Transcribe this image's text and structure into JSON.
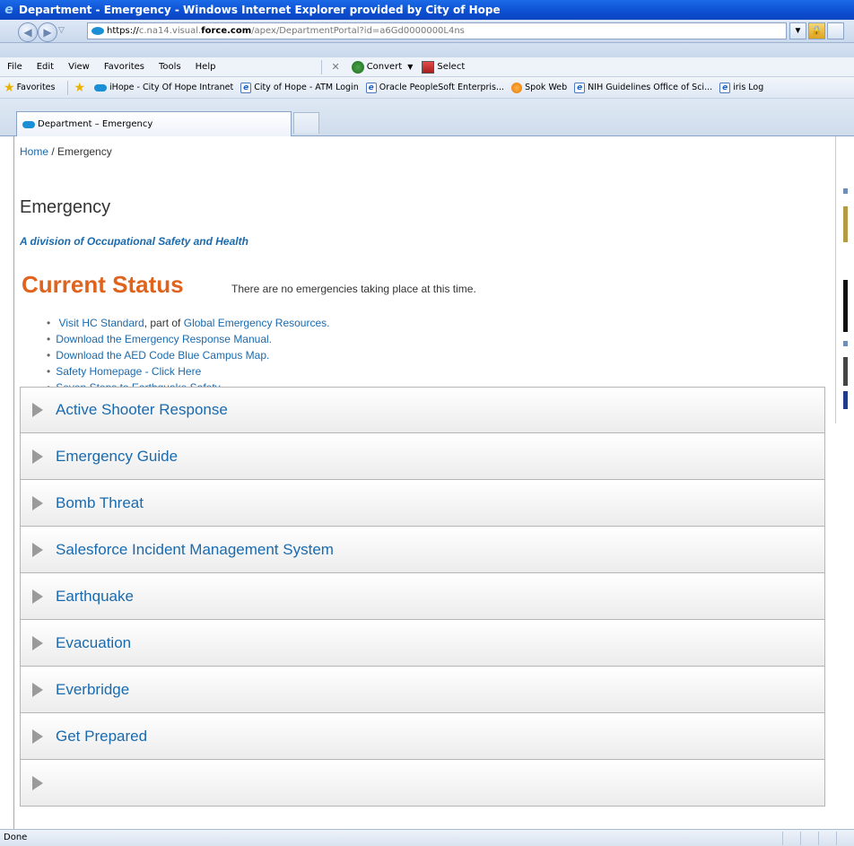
{
  "window": {
    "title": "Department - Emergency - Windows Internet Explorer provided by City of Hope"
  },
  "address": {
    "url_prefix": "https://",
    "url_host_start": "c.na14.visual.",
    "url_domain": "force.com",
    "url_path": "/apex/DepartmentPortal?id=a6Gd0000000L4ns"
  },
  "menu": {
    "items": [
      "File",
      "Edit",
      "View",
      "Favorites",
      "Tools",
      "Help"
    ],
    "convert_label": "Convert",
    "select_label": "Select"
  },
  "favorites": {
    "label": "Favorites",
    "links": [
      "iHope - City Of Hope Intranet",
      "City of Hope - ATM Login",
      "Oracle PeopleSoft Enterpris...",
      "Spok Web",
      "NIH Guidelines Office of Sci...",
      "iris Log"
    ]
  },
  "tab": {
    "label": "Department – Emergency"
  },
  "page": {
    "breadcrumb_home": "Home",
    "breadcrumb_sep": " / ",
    "breadcrumb_current": "Emergency",
    "title": "Emergency",
    "subtitle": "A division of Occupational Safety and Health",
    "status_heading": "Current Status",
    "status_message": "There are no emergencies taking place at this time.",
    "links": {
      "hc_standard": "Visit HC Standard",
      "hc_part_of": ", part of ",
      "global_resources": "Global Emergency Resources.",
      "response_manual": "Download the Emergency Response Manual.",
      "aed_map": "Download the AED Code Blue Campus Map.",
      "safety_homepage": "Safety Homepage - Click Here",
      "earthquake_steps": "Seven Steps to Earthquake Safety"
    },
    "accordion": [
      "Active Shooter Response",
      "Emergency Guide",
      "Bomb Threat",
      "Salesforce Incident Management System",
      "Earthquake",
      "Evacuation",
      "Everbridge",
      "Get Prepared"
    ]
  },
  "status": {
    "text": "Done"
  },
  "colors": {
    "link": "#1a6aae",
    "status_heading": "#e0631d",
    "titlebar": "#0c4fd0"
  }
}
